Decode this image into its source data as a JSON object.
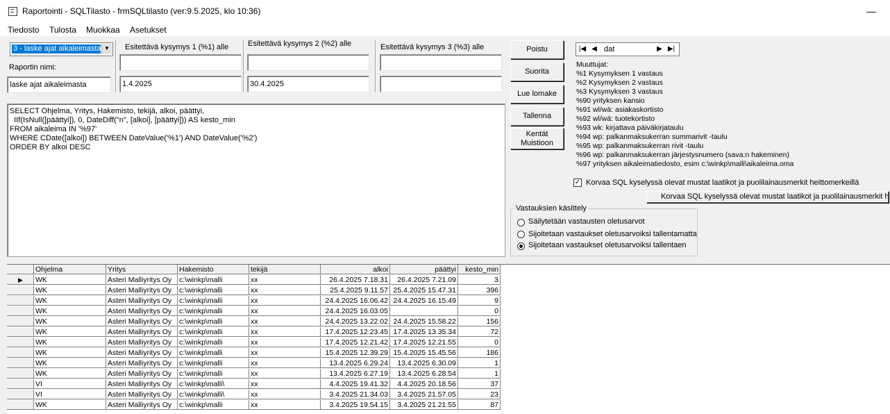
{
  "window": {
    "title": "Raportointi - SQLTilasto - frmSQLtilasto (ver:9.5.2025, klo 10:36)",
    "minimize_glyph": "—"
  },
  "menu": [
    {
      "label": "Tiedosto"
    },
    {
      "label": "Tulosta"
    },
    {
      "label": "Muokkaa"
    },
    {
      "label": "Asetukset"
    }
  ],
  "report_select": {
    "value": "3 - laske ajat aikaleimasta"
  },
  "report_name": {
    "label": "Raportin nimi:",
    "value": "laske ajat aikaleimasta"
  },
  "questions": [
    {
      "label": "Esitettävä kysymys 1 (%1) alle",
      "prompt": "",
      "value": "1.4.2025"
    },
    {
      "label": "Esitettävä kysymys 2 (%2) alle",
      "prompt": "",
      "value": "30.4.2025"
    },
    {
      "label": "Esitettävä kysymys 3 (%3) alle",
      "prompt": "",
      "value": ""
    }
  ],
  "buttons": {
    "poistu": "Poistu",
    "suorita": "Suorita",
    "lue_lomake": "Lue lomake",
    "tallenna": "Tallenna",
    "kentat_line1": "Kentät",
    "kentat_line2": "Muistioon",
    "korvaa": "Korvaa SQL kyselyssä olevat mustat laatikot ja  puolilainausmerkit heittomerkeillä"
  },
  "sql_lines": [
    "SELECT Ohjelma, Yritys, Hakemisto, tekijä, alkoi, päättyi,",
    "  IIf(IsNull([päättyi]), 0, DateDiff(\"n\", [alkoi], [päättyi])) AS kesto_min",
    "FROM aikaleima IN '%97'",
    "WHERE CDate([alkoi]) BETWEEN DateValue('%1') AND DateValue('%2')",
    "ORDER BY alkoi DESC"
  ],
  "navigator": {
    "value": "dat"
  },
  "variables": {
    "title": "Muuttujat:",
    "items": [
      "%1 Kysymyksen 1 vastaus",
      "%2 Kysymyksen 2 vastaus",
      "%3 Kysymyksen 3 vastaus",
      "%90 yrityksen kansio",
      "%91 wl/wä: asiakaskortisto",
      "%92 wl/wä: tuotekortisto",
      "%93 wk: kirjattava päiväkirjataulu",
      "%94 wp: palkanmaksukerran summarivit -taulu",
      "%95 wp: palkanmaksukerran rivit -taulu",
      "%96 wp: palkanmaksukerran järjestysnumero (sava:n hakeminen)",
      "%97 yrityksen aikaleimatiedosto, esim c:\\winkp\\malli\\aikaleima.oma"
    ]
  },
  "replace_checkbox": {
    "label": "Korvaa SQL kyselyssä olevat mustat laatikot ja  puolilainausmerkit heittomerkeillä",
    "checked": true
  },
  "answers_group": {
    "title": "Vastauksien käsittely",
    "options": [
      {
        "label": "Säilytetään vastausten oletusarvot",
        "selected": false
      },
      {
        "label": "Sijoitetaan vastaukset oletusarvoiksi tallentamatta",
        "selected": false
      },
      {
        "label": "Sijoitetaan vastaukset oletusarvoiksi tallentaen",
        "selected": true
      }
    ]
  },
  "grid": {
    "columns": [
      "Ohjelma",
      "Yritys",
      "Hakemisto",
      "tekijä",
      "alkoi",
      "päättyi",
      "kesto_min"
    ],
    "rows": [
      [
        "WK",
        "Asteri Malliyritys Oy",
        "c:\\winkp\\malli",
        "xx",
        "26.4.2025 7.18.31",
        "26.4.2025 7.21.09",
        "3"
      ],
      [
        "WK",
        "Asteri Malliyritys Oy",
        "c:\\winkp\\malli",
        "xx",
        "25.4.2025 9.11.57",
        "25.4.2025 15.47.31",
        "396"
      ],
      [
        "WK",
        "Asteri Malliyritys Oy",
        "c:\\winkp\\malli",
        "xx",
        "24.4.2025 16.06.42",
        "24.4.2025 16.15.49",
        "9"
      ],
      [
        "WK",
        "Asteri Malliyritys Oy",
        "c:\\winkp\\malli",
        "xx",
        "24.4.2025 16.03.05",
        "",
        "0"
      ],
      [
        "WK",
        "Asteri Malliyritys Oy",
        "c:\\winkp\\malli",
        "xx",
        "24.4.2025 13.22.02",
        "24.4.2025 15.58.22",
        "156"
      ],
      [
        "WK",
        "Asteri Malliyritys Oy",
        "c:\\winkp\\malli",
        "xx",
        "17.4.2025 12.23.45",
        "17.4.2025 13.35.34",
        "72"
      ],
      [
        "WK",
        "Asteri Malliyritys Oy",
        "c:\\winkp\\malli",
        "xx",
        "17.4.2025 12.21.42",
        "17.4.2025 12.21.55",
        "0"
      ],
      [
        "WK",
        "Asteri Malliyritys Oy",
        "c:\\winkp\\malli",
        "xx",
        "15.4.2025 12.39.29",
        "15.4.2025 15.45.56",
        "186"
      ],
      [
        "WK",
        "Asteri Malliyritys Oy",
        "c:\\winkp\\malli",
        "xx",
        "13.4.2025 6.29.24",
        "13.4.2025 6.30.09",
        "1"
      ],
      [
        "WK",
        "Asteri Malliyritys Oy",
        "c:\\winkp\\malli",
        "xx",
        "13.4.2025 6.27.19",
        "13.4.2025 6.28.54",
        "1"
      ],
      [
        "VI",
        "Asteri Malliyritys Oy",
        "c:\\winkp\\malli\\",
        "xx",
        "4.4.2025 19.41.32",
        "4.4.2025 20.18.56",
        "37"
      ],
      [
        "VI",
        "Asteri Malliyritys Oy",
        "c:\\winkp\\malli\\",
        "xx",
        "3.4.2025 21.34.03",
        "3.4.2025 21.57.05",
        "23"
      ],
      [
        "WK",
        "Asteri Malliyritys Oy",
        "c:\\winkp\\malli",
        "xx",
        "3.4.2025 19.54.15",
        "3.4.2025 21.21.55",
        "87"
      ]
    ]
  }
}
